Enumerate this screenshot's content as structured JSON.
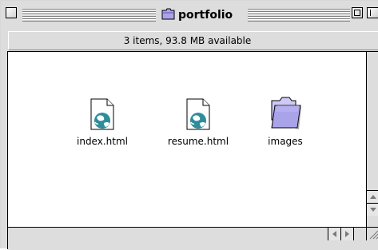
{
  "window": {
    "title": "portfolio",
    "title_icon": "folder-icon"
  },
  "infobar": {
    "status": "3 items, 93.8 MB available"
  },
  "items": [
    {
      "label": "index.html",
      "icon": "html-document-icon"
    },
    {
      "label": "resume.html",
      "icon": "html-document-icon"
    },
    {
      "label": "images",
      "icon": "folder-icon"
    }
  ],
  "colors": {
    "window_gray": "#dddddd",
    "folder_purple": "#a9a3ea",
    "globe_teal": "#2d8d9b"
  }
}
